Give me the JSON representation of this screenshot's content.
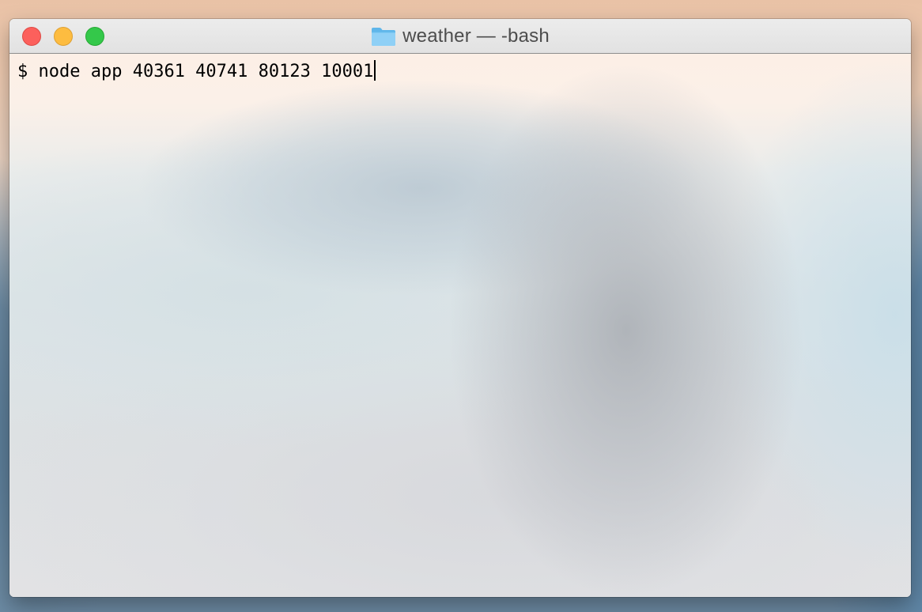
{
  "window": {
    "title": "weather — -bash",
    "folder_icon": "folder-icon",
    "controls": {
      "close_color": "#fc605c",
      "minimize_color": "#fdbc40",
      "zoom_color": "#34c84a"
    }
  },
  "terminal": {
    "prompt": "$",
    "command": "node app 40361 40741 80123 10001"
  }
}
